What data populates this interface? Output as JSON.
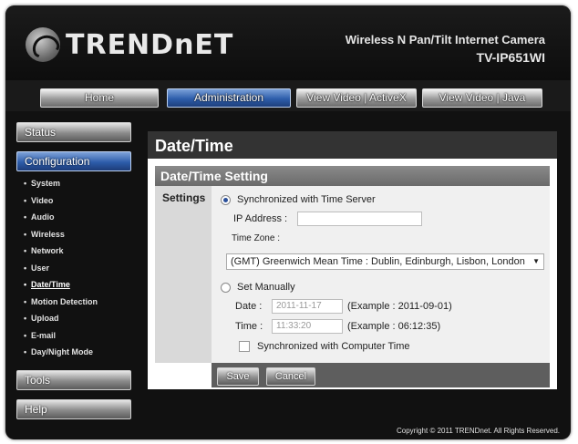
{
  "brand": {
    "logo_text": "TRENDnET"
  },
  "product": {
    "line1": "Wireless N Pan/Tilt Internet Camera",
    "model": "TV-IP651WI"
  },
  "topnav": {
    "items": [
      {
        "label": "Home"
      },
      {
        "label": "Administration"
      },
      {
        "label": "View Video | ActiveX"
      },
      {
        "label": "View Video | Java"
      }
    ],
    "active_label": "Administration"
  },
  "sidebar": {
    "status_label": "Status",
    "configuration_label": "Configuration",
    "items": [
      {
        "label": "System"
      },
      {
        "label": "Video"
      },
      {
        "label": "Audio"
      },
      {
        "label": "Wireless"
      },
      {
        "label": "Network"
      },
      {
        "label": "User"
      },
      {
        "label": "Date/Time"
      },
      {
        "label": "Motion Detection"
      },
      {
        "label": "Upload"
      },
      {
        "label": "E-mail"
      },
      {
        "label": "Day/Night Mode"
      }
    ],
    "current_item": "Date/Time",
    "tools_label": "Tools",
    "help_label": "Help"
  },
  "page": {
    "title": "Date/Time",
    "section_title": "Date/Time Setting",
    "settings_label": "Settings"
  },
  "form": {
    "sync_option_label": "Synchronized with Time Server",
    "sync_selected": true,
    "ip_label": "IP Address  :",
    "ip_value": "",
    "timezone_label": "Time Zone  :",
    "timezone_value": "(GMT) Greenwich Mean Time : Dublin, Edinburgh, Lisbon, London",
    "manual_option_label": "Set Manually",
    "manual_selected": false,
    "date_label": "Date  :",
    "date_value": "2011-11-17",
    "date_example": "(Example : 2011-09-01)",
    "time_label": "Time  :",
    "time_value": "11:33:20",
    "time_example": "(Example : 06:12:35)",
    "sync_pc_label": "Synchronized with Computer Time",
    "sync_pc_checked": false
  },
  "buttons": {
    "save": "Save",
    "cancel": "Cancel"
  },
  "footer": {
    "copyright": "Copyright © 2011 TRENDnet. All Rights Reserved."
  },
  "colors": {
    "active_blue": "#2d5dab",
    "page_title_bg": "#333333",
    "section_bg": "#7a7a7a"
  }
}
